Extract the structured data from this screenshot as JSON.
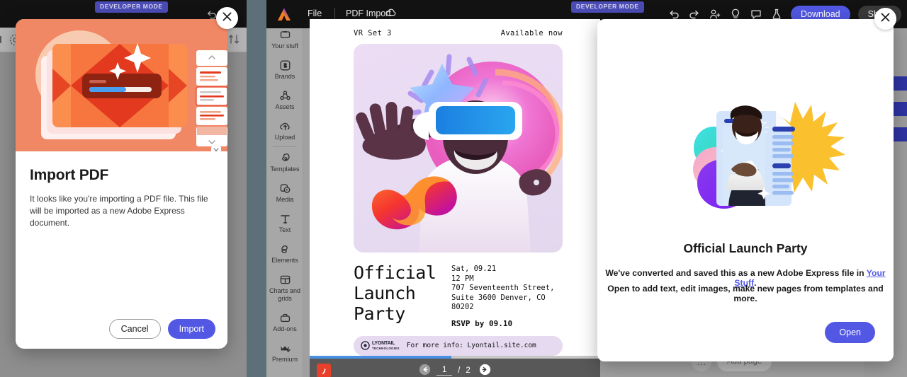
{
  "badges": {
    "developer_mode": "DEVELOPER MODE"
  },
  "express": {
    "menu": {
      "file": "File",
      "doc_name": "PDF Import"
    },
    "toolbar": {
      "undo": "undo-icon",
      "redo": "redo-icon",
      "invite": "invite-user-icon",
      "ideas": "lightbulb-icon",
      "comments": "comment-icon",
      "labs": "beaker-icon",
      "download": "Download",
      "share": "Share"
    },
    "rail": [
      {
        "label": "Your stuff",
        "icon": "your-stuff-icon"
      },
      {
        "label": "Brands",
        "icon": "brands-icon"
      },
      {
        "label": "Assets",
        "icon": "assets-icon"
      },
      {
        "label": "Upload",
        "icon": "upload-icon"
      },
      {
        "label": "Templates",
        "icon": "templates-icon"
      },
      {
        "label": "Media",
        "icon": "media-icon"
      },
      {
        "label": "Text",
        "icon": "text-icon"
      },
      {
        "label": "Elements",
        "icon": "elements-icon"
      },
      {
        "label": "Charts and grids",
        "icon": "charts-grids-icon"
      },
      {
        "label": "Add-ons",
        "icon": "add-ons-icon"
      },
      {
        "label": "Premium",
        "icon": "premium-crown-icon"
      }
    ],
    "canvas_footer": {
      "more": "…",
      "add_page": "Add page"
    }
  },
  "pdf_preview": {
    "doc": {
      "eyebrow_left": "VR Set 3",
      "eyebrow_right": "Available now",
      "title": "Official Launch Party",
      "date": "Sat, 09.21",
      "time": "12 PM",
      "address_line1": "707 Seventeenth Street,",
      "address_line2": "Suite 3600 Denver, CO",
      "address_line3": "80202",
      "rsvp": "RSVP by 09.10",
      "brand": "LYONTAIL TECHNOLOGIES",
      "more_info": "For more info: Lyontail.site.com"
    },
    "toolbar": {
      "app_icon": "acrobat-icon",
      "prev": "prev-page-icon",
      "next": "next-page-icon",
      "current_page": "1",
      "page_separator": "/",
      "total_pages": "2"
    }
  },
  "import_dialog": {
    "title": "Import PDF",
    "body": "It looks like you're importing a PDF file. This file will be imported as a new Adobe Express document.",
    "cancel_label": "Cancel",
    "import_label": "Import",
    "close_label": "close-icon"
  },
  "launch_dialog": {
    "title": "Official Launch Party",
    "line1_a": "We've converted and saved this as a new Adobe Express file in ",
    "line1_link": "Your Stuff",
    "line1_b": ".",
    "line2": "Open to add text, edit images, make new pages from templates and more.",
    "open_label": "Open",
    "close_label": "close-icon"
  },
  "colors": {
    "accent_indigo": "#5258e4",
    "hero_orange": "#f08765",
    "dev_badge": "#4b4bb5",
    "link": "#5258e4",
    "acrobat_red": "#e8402a"
  }
}
